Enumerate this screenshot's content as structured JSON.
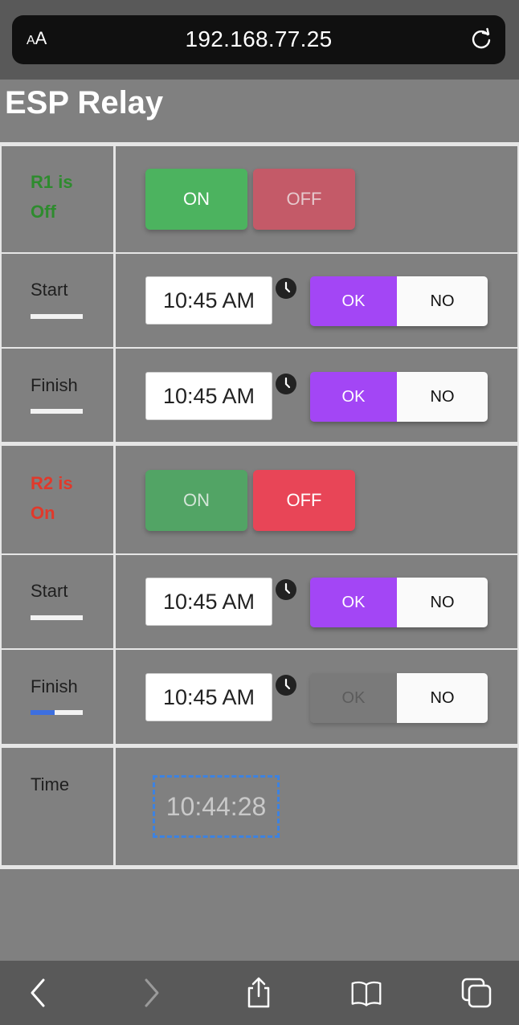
{
  "browser": {
    "text_size_label": "AA",
    "url": "192.168.77.25"
  },
  "page": {
    "title": "ESP Relay"
  },
  "relay1": {
    "status_line1": "R1 is",
    "status_line2": "Off",
    "status_color": "#2e8b2e",
    "on_label": "ON",
    "off_label": "OFF",
    "start_label": "Start",
    "start_time": "10:45 AM",
    "start_ok": "OK",
    "start_no": "NO",
    "finish_label": "Finish",
    "finish_time": "10:45 AM",
    "finish_ok": "OK",
    "finish_no": "NO"
  },
  "relay2": {
    "status_line1": "R2 is",
    "status_line2": "On",
    "status_color": "#e0392b",
    "on_label": "ON",
    "off_label": "OFF",
    "start_label": "Start",
    "start_time": "10:45 AM",
    "start_ok": "OK",
    "start_no": "NO",
    "finish_label": "Finish",
    "finish_time": "10:45 AM",
    "finish_ok": "OK",
    "finish_no": "NO"
  },
  "clock": {
    "label": "Time",
    "value": "10:44:28"
  },
  "colors": {
    "on_active": "#4cb35f",
    "on_inactive": "#52a465",
    "off_active": "#e84557",
    "off_inactive": "#c45a68",
    "toggle_accent": "#a346f5",
    "focus_blue": "#3d82e0"
  },
  "toolbar": {
    "icons": [
      "back-icon",
      "forward-icon",
      "share-icon",
      "bookmarks-icon",
      "tabs-icon"
    ]
  }
}
